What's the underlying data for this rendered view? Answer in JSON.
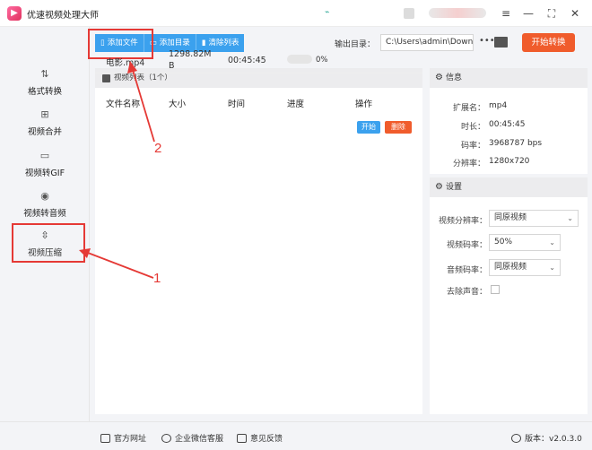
{
  "titlebar": {
    "app_title": "优速视频处理大师"
  },
  "sidebar": {
    "items": [
      {
        "label": "格式转换",
        "icon": "format-convert-icon"
      },
      {
        "label": "视频合并",
        "icon": "merge-icon"
      },
      {
        "label": "视频转GIF",
        "icon": "gif-icon"
      },
      {
        "label": "视频转音频",
        "icon": "audio-icon"
      },
      {
        "label": "视频压缩",
        "icon": "compress-icon",
        "active": true
      }
    ]
  },
  "toolbar": {
    "add_file": "添加文件",
    "add_folder": "添加目录",
    "clear_list": "清除列表",
    "output_label": "输出目录：",
    "output_path": "C:\\Users\\admin\\Downlo",
    "start_convert": "开始转换"
  },
  "list": {
    "header": "视频列表（1个）",
    "columns": [
      "文件名称",
      "大小",
      "时间",
      "进度",
      "操作"
    ],
    "rows": [
      {
        "name": "电影.mp4",
        "size_line1": "1298.82M",
        "size_line2": "B",
        "time": "00:45:45",
        "progress_text": "0%",
        "progress": 0,
        "start": "开始",
        "delete": "删除"
      }
    ]
  },
  "info": {
    "title": "信息",
    "fields": [
      {
        "label": "扩展名：",
        "value": "mp4"
      },
      {
        "label": "时长：",
        "value": "00:45:45"
      },
      {
        "label": "码率：",
        "value": "3968787 bps"
      },
      {
        "label": "分辨率：",
        "value": "1280x720"
      }
    ]
  },
  "settings": {
    "title": "设置",
    "resolution_label": "视频分辨率：",
    "resolution_value": "同原视频",
    "bitrate_label": "视频码率：",
    "bitrate_value": "50%",
    "audio_label": "音频码率：",
    "audio_value": "同原视频",
    "mute_label": "去除声音："
  },
  "footer": {
    "website": "官方网址",
    "wechat": "企业微信客服",
    "feedback": "意见反馈",
    "version": "版本：v2.0.3.0"
  },
  "annotations": {
    "one": "1",
    "two": "2"
  },
  "colors": {
    "accent": "#3ba1ee",
    "orange": "#f05c2c",
    "annot_red": "#e53935"
  }
}
